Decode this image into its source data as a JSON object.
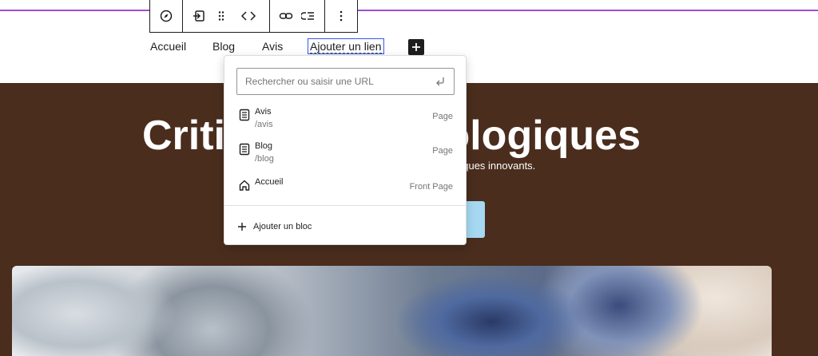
{
  "toolbar": {
    "groups": [
      [
        "compass-icon"
      ],
      [
        "indent-icon",
        "drag-handle-icon",
        "chevrons-icon"
      ],
      [
        "link-icon",
        "submenu-icon"
      ],
      [
        "more-vertical-icon"
      ]
    ]
  },
  "nav": {
    "items": [
      {
        "label": "Accueil"
      },
      {
        "label": "Blog"
      },
      {
        "label": "Avis"
      },
      {
        "label": "Ajouter un lien"
      }
    ],
    "add_icon": "plus-icon"
  },
  "hero": {
    "title": "Critiques technologiques",
    "subtitle": "Découvrez nos critiques de produits technologiques innovants."
  },
  "link_popover": {
    "search_placeholder": "Rechercher ou saisir une URL",
    "results": [
      {
        "title": "Avis",
        "url": "/avis",
        "type": "Page",
        "icon": "page-icon"
      },
      {
        "title": "Blog",
        "url": "/blog",
        "type": "Page",
        "icon": "page-icon"
      },
      {
        "title": "Accueil",
        "url": "",
        "type": "Front Page",
        "icon": "home-icon"
      }
    ],
    "add_block_label": "Ajouter un bloc"
  },
  "colors": {
    "hero_bg": "#4a2d1d",
    "accent_purple": "#9b4fd3",
    "focus_blue": "#3858e9",
    "button_light_blue": "#a6d8f2"
  }
}
